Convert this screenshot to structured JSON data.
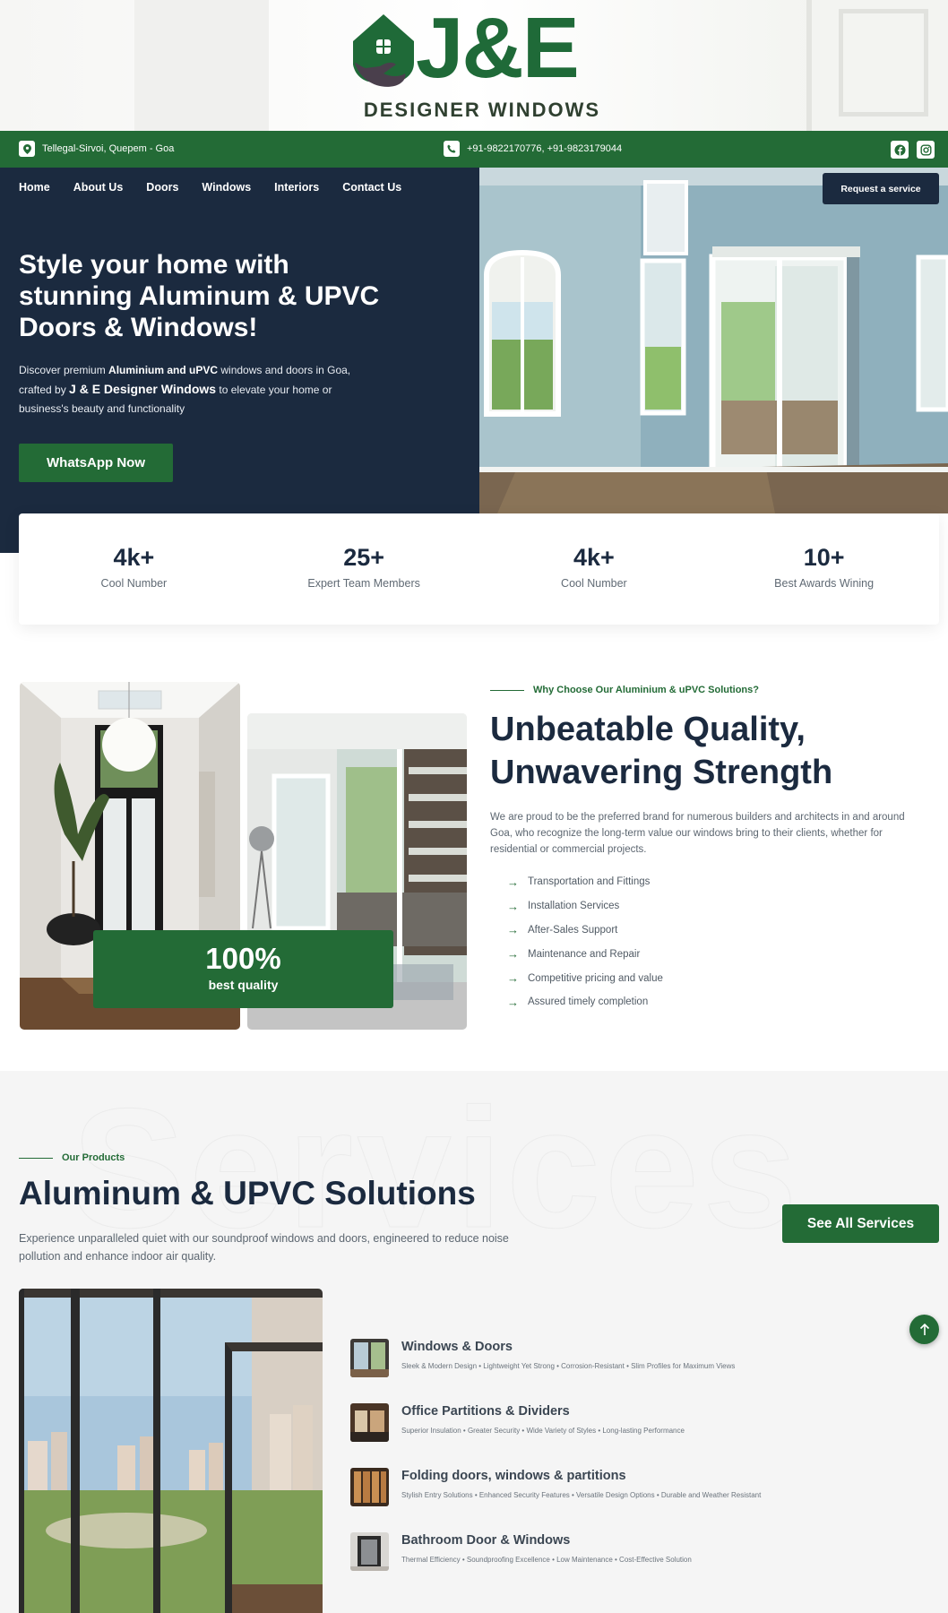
{
  "brand": {
    "logo_main": "J&E",
    "logo_sub": "DESIGNER WINDOWS"
  },
  "topbar": {
    "location": "Tellegal-Sirvoi, Quepem - Goa",
    "phone": "+91-9822170776, +91-9823179044",
    "social_icons": [
      "facebook-icon",
      "instagram-icon"
    ],
    "bg_color": "#236b36"
  },
  "nav": {
    "items": [
      "Home",
      "About Us",
      "Doors",
      "Windows",
      "Interiors",
      "Contact Us"
    ]
  },
  "header": {
    "request_button": "Request a service"
  },
  "hero": {
    "title": "Style your home with stunning Aluminum & UPVC Doors & Windows!",
    "desc_1": "Discover premium ",
    "desc_bold_1": "Aluminium and uPVC",
    "desc_2": " windows and doors in Goa, crafted by ",
    "desc_bold_2": "J & E Designer Windows",
    "desc_3": " to elevate your home or business's beauty and functionality",
    "cta": "WhatsApp Now",
    "bg_color": "#1b2a3f"
  },
  "stats": [
    {
      "number": "4k+",
      "label": "Cool Number"
    },
    {
      "number": "25+",
      "label": "Expert Team Members"
    },
    {
      "number": "4k+",
      "label": "Cool Number"
    },
    {
      "number": "10+",
      "label": "Best Awards Wining"
    }
  ],
  "why": {
    "eyebrow": "Why Choose Our Aluminium & uPVC Solutions?",
    "title": "Unbeatable Quality, Unwavering Strength",
    "description": "We are proud to be the preferred brand for numerous builders and architects in and around Goa, who recognize the long-term value our windows bring to their clients, whether for residential or commercial projects.",
    "list": [
      "Transportation and Fittings",
      "Installation Services",
      "After-Sales Support",
      "Maintenance and Repair",
      "Competitive pricing and value",
      "Assured timely completion"
    ],
    "badge_number": "100%",
    "badge_label": "best quality"
  },
  "services": {
    "watermark": "Services",
    "eyebrow": "Our Products",
    "title": "Aluminum & UPVC Solutions",
    "description": "Experience unparalleled quiet with our soundproof windows and doors, engineered to reduce noise pollution and enhance indoor air quality.",
    "see_all": "See All Services",
    "products": [
      {
        "name": "Windows & Doors",
        "features": "Sleek & Modern Design •  Lightweight Yet Strong •  Corrosion-Resistant •  Slim Profiles for Maximum Views"
      },
      {
        "name": "Office Partitions & Dividers",
        "features": "Superior Insulation •  Greater Security •  Wide Variety of Styles •  Long-lasting Performance"
      },
      {
        "name": "Folding doors, windows & partitions",
        "features": "Stylish Entry Solutions •  Enhanced Security Features •  Versatile Design Options •  Durable and Weather Resistant"
      },
      {
        "name": "Bathroom Door & Windows",
        "features": "Thermal Efficiency •  Soundproofing Excellence •  Low Maintenance •  Cost-Effective Solution"
      }
    ]
  }
}
